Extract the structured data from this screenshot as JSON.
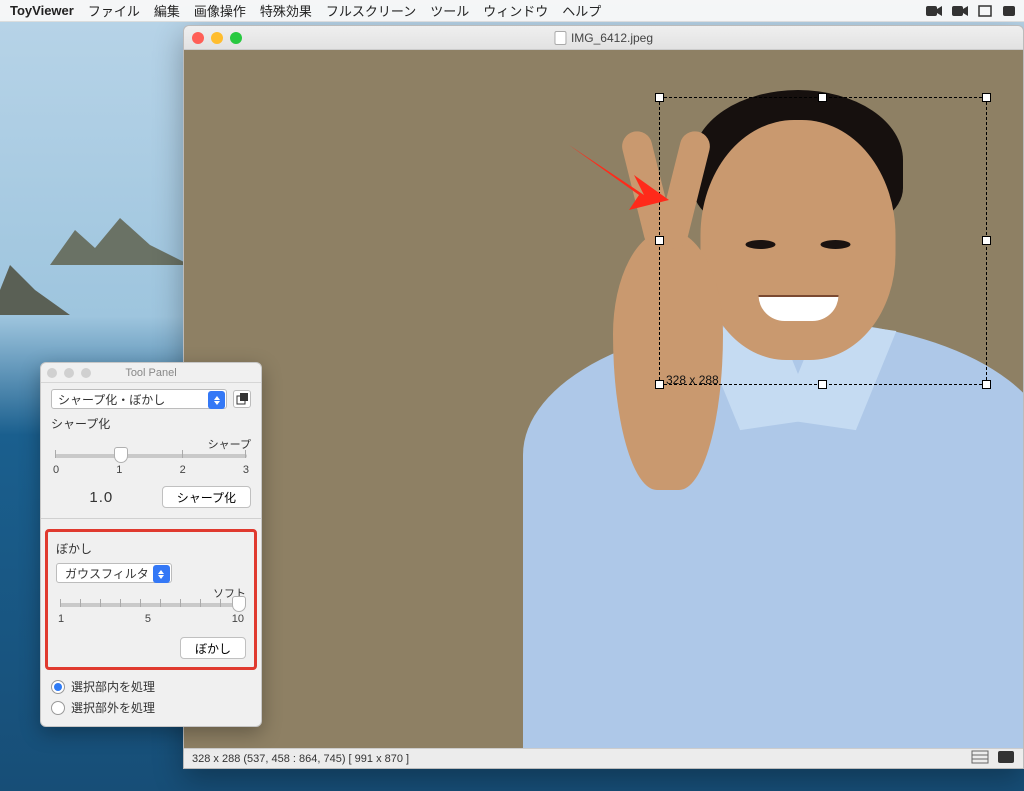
{
  "menubar": {
    "app": "ToyViewer",
    "items": [
      "ファイル",
      "編集",
      "画像操作",
      "特殊効果",
      "フルスクリーン",
      "ツール",
      "ウィンドウ",
      "ヘルプ"
    ]
  },
  "image_window": {
    "filename": "IMG_6412.jpeg",
    "selection_label": "328  x  288",
    "status": "328 x 288  (537, 458 : 864, 745)  [ 991 x 870 ]"
  },
  "tool_panel": {
    "title": "Tool Panel",
    "mode_select": "シャープ化・ぼかし",
    "sharpen": {
      "label": "シャープ化",
      "caption": "シャープ",
      "ticks": [
        "0",
        "1",
        "2",
        "3"
      ],
      "value": "1.0",
      "button": "シャープ化"
    },
    "blur": {
      "label": "ぼかし",
      "filter_select": "ガウスフィルタ",
      "caption": "ソフト",
      "ticks": [
        "1",
        "5",
        "10"
      ],
      "button": "ぼかし"
    },
    "radios": {
      "inside": "選択部内を処理",
      "outside": "選択部外を処理"
    }
  }
}
